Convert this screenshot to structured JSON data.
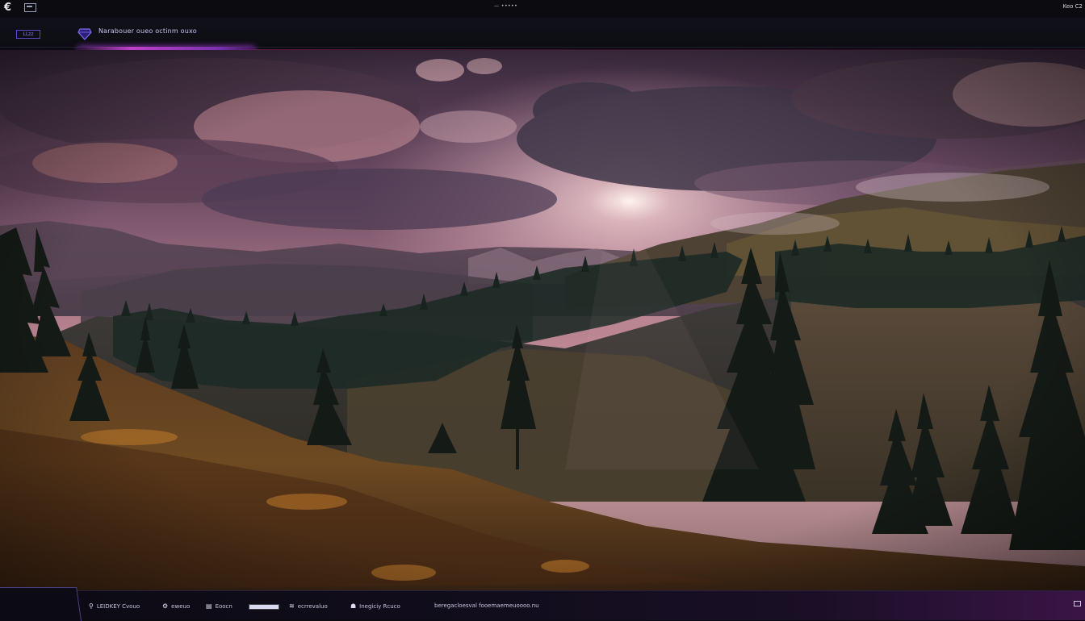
{
  "topbar": {
    "center_text": "— •••••",
    "right_text": "Keo C2"
  },
  "header": {
    "left_button_label": "LLzz",
    "title": "Narabouer oueo octinm ouxo"
  },
  "bottombar": {
    "items": [
      {
        "icon": "pin-icon",
        "label": "LEIDKEY Cvouo"
      },
      {
        "icon": "gear-icon",
        "label": "eweuo"
      },
      {
        "icon": "file-icon",
        "label": "Eoocn"
      },
      {
        "icon": "layers-icon",
        "label": "ecrrevaluo"
      },
      {
        "icon": "person-icon",
        "label": "Inegiciy Rcuco"
      },
      {
        "icon": "",
        "label": "beregacloesval fooemaemeuoooo.nu"
      }
    ],
    "progress_value": 1.0
  },
  "colors": {
    "accent_purple": "#8d82f0",
    "glow_magenta": "#c040c8"
  }
}
